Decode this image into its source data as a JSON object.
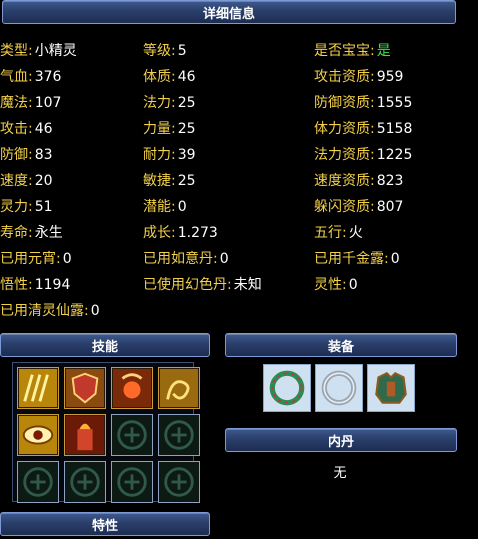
{
  "header": {
    "title": "详细信息"
  },
  "stats": {
    "rows": [
      [
        {
          "label": "类型:",
          "value": "小精灵"
        },
        {
          "label": "等级:",
          "value": "5"
        },
        {
          "label": "是否宝宝:",
          "value": "是"
        }
      ],
      [
        {
          "label": "气血:",
          "value": "376"
        },
        {
          "label": "体质:",
          "value": "46"
        },
        {
          "label": "攻击资质:",
          "value": "959"
        }
      ],
      [
        {
          "label": "魔法:",
          "value": "107"
        },
        {
          "label": "法力:",
          "value": "25"
        },
        {
          "label": "防御资质:",
          "value": "1555"
        }
      ],
      [
        {
          "label": "攻击:",
          "value": "46"
        },
        {
          "label": "力量:",
          "value": "25"
        },
        {
          "label": "体力资质:",
          "value": "5158"
        }
      ],
      [
        {
          "label": "防御:",
          "value": "83"
        },
        {
          "label": "耐力:",
          "value": "39"
        },
        {
          "label": "法力资质:",
          "value": "1225"
        }
      ],
      [
        {
          "label": "速度:",
          "value": "20"
        },
        {
          "label": "敏捷:",
          "value": "25"
        },
        {
          "label": "速度资质:",
          "value": "823"
        }
      ],
      [
        {
          "label": "灵力:",
          "value": "51"
        },
        {
          "label": "潜能:",
          "value": "0"
        },
        {
          "label": "躲闪资质:",
          "value": "807"
        }
      ],
      [
        {
          "label": "寿命:",
          "value": "永生"
        },
        {
          "label": "成长:",
          "value": "1.273"
        },
        {
          "label": "五行:",
          "value": "火"
        }
      ],
      [
        {
          "label": "已用元宵:",
          "value": "0"
        },
        {
          "label": "已用如意丹:",
          "value": "0"
        },
        {
          "label": "已用千金露:",
          "value": "0"
        }
      ],
      [
        {
          "label": "悟性:",
          "value": "1194"
        },
        {
          "label": "已使用幻色丹:",
          "value": "未知"
        },
        {
          "label": "灵性:",
          "value": "0"
        }
      ],
      [
        {
          "label": "已用清灵仙露:",
          "value": "0"
        }
      ]
    ],
    "highlight_color": "#3be34a"
  },
  "sections": {
    "skills_title": "技能",
    "equipment_title": "装备",
    "neidan_title": "内丹",
    "neidan_value": "无",
    "traits_title": "特性"
  },
  "skills": [
    "claw-icon",
    "shield-icon",
    "fire-spirit-icon",
    "fire-curl-icon",
    "eye-icon",
    "flame-tower-icon",
    "empty",
    "empty",
    "empty",
    "empty",
    "empty",
    "empty"
  ],
  "equipment": [
    "jade-ring-icon",
    "silver-ring-icon",
    "armor-icon"
  ]
}
